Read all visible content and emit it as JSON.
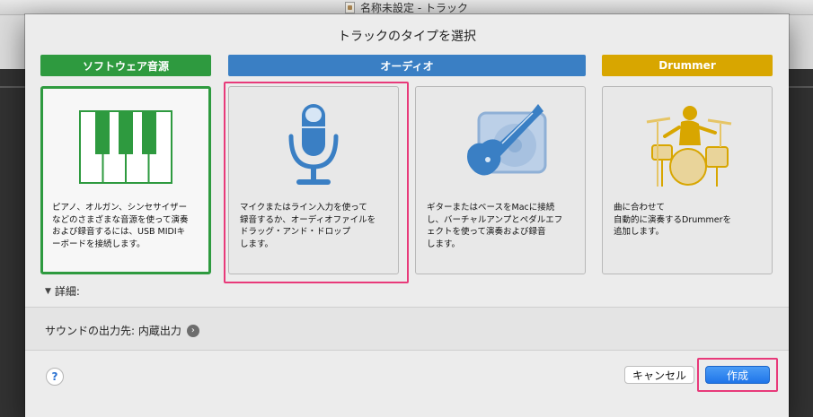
{
  "window": {
    "title": "名称未設定 - トラック"
  },
  "dialog": {
    "title": "トラックのタイプを選択",
    "categories": [
      {
        "label": "ソフトウェア音源",
        "color": "#2e9a3f"
      },
      {
        "label": "オーディオ",
        "color": "#3a7fc4"
      },
      {
        "label": "Drummer",
        "color": "#d8a600"
      }
    ],
    "cards": [
      {
        "icon": "piano-keyboard-icon",
        "selected": true,
        "description": "ピアノ、オルガン、シンセサイザー\nなどのさまざまな音源を使って演奏\nおよび録音するには、USB MIDIキ\nーボードを接続します。"
      },
      {
        "icon": "microphone-icon",
        "description": "マイクまたはライン入力を使って\n録音するか、オーディオファイルを\nドラッグ・アンド・ドロップ\nします。"
      },
      {
        "icon": "guitar-amp-icon",
        "description": "ギターまたはベースをMacに接続\nし、バーチャルアンプとペダルエフ\nェクトを使って演奏および録音\nします。"
      },
      {
        "icon": "drummer-icon",
        "description": "曲に合わせて\n自動的に演奏するDrummerを\n追加します。"
      }
    ],
    "details_label": "詳細:",
    "output_label": "サウンドの出力先: 内蔵出力",
    "help_label": "?",
    "cancel_label": "キャンセル",
    "create_label": "作成"
  },
  "colors": {
    "highlight": "#e83a7a",
    "primary": "#1f75e9"
  }
}
